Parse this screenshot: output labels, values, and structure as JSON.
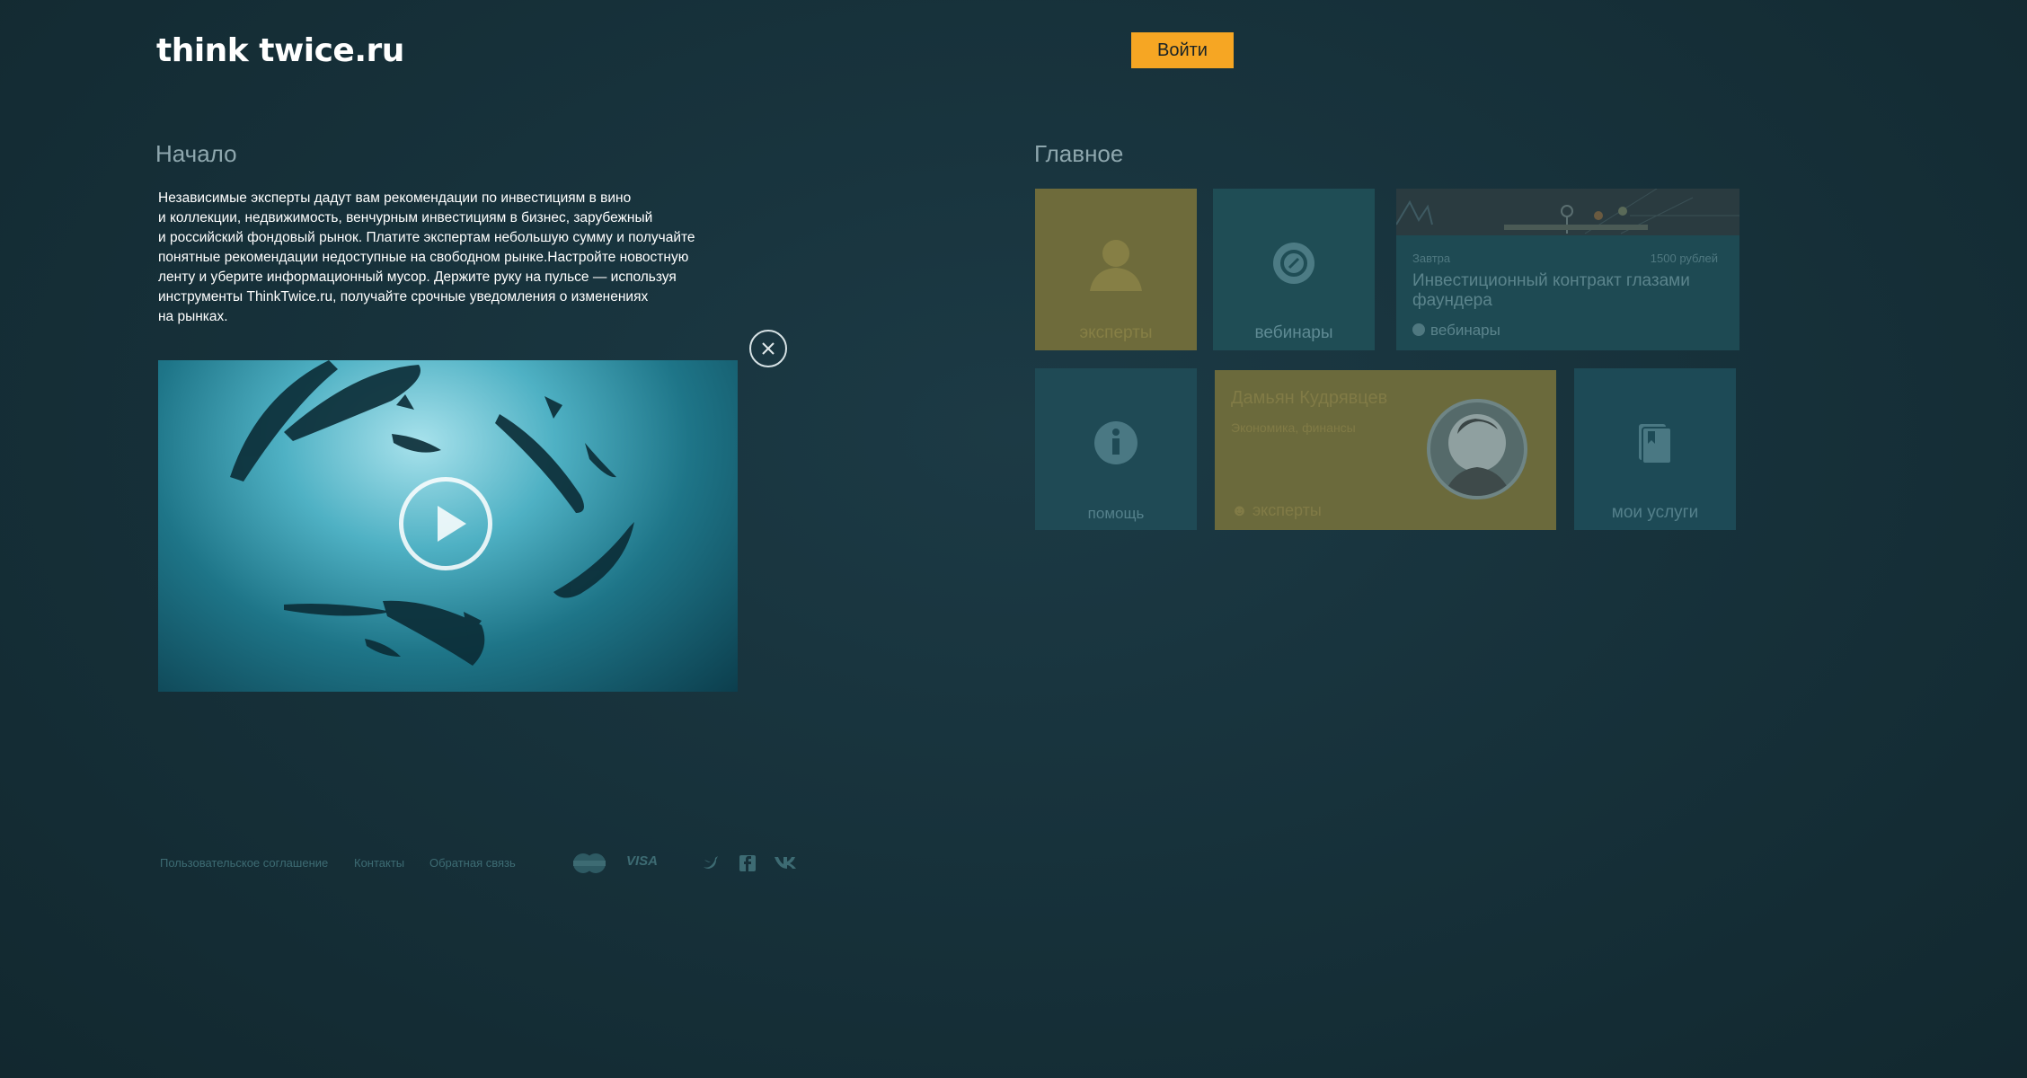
{
  "header": {
    "logo": "think twice.ru",
    "login_label": "Войти"
  },
  "start": {
    "title": "Начало",
    "intro_lines": [
      "Независимые эксперты дадут вам рекомендации по инвестициям в вино",
      "и коллекции, недвижимость, венчурным инвестициям в бизнес, зарубежный",
      "и российский фондовый рынок. Платите экспертам небольшую сумму и получайте",
      "понятные рекомендации недоступные на свободном рынке.Настройте новостную",
      "ленту и уберите информационный мусор. Держите руку на пульсе — используя",
      "инструменты ThinkTwice.ru, получайте срочные уведомления о изменениях",
      "на рынках."
    ]
  },
  "video": {
    "play_icon": "play-icon",
    "close_icon": "close-icon"
  },
  "main": {
    "title": "Главное",
    "tiles": {
      "experts": {
        "label": "эксперты",
        "icon": "person-icon"
      },
      "webinars": {
        "label": "вебинары",
        "icon": "webinar-icon"
      },
      "event": {
        "date": "Завтра",
        "price": "1500 рублей",
        "title": "Инвестиционный контракт глазами фаундера",
        "category": "вебинары"
      },
      "help": {
        "label": "помощь",
        "icon": "info-icon"
      },
      "expert_card": {
        "name": "Дамьян Кудрявцев",
        "field": "Экономика, финансы",
        "category": "эксперты"
      },
      "services": {
        "label": "мои услуги",
        "icon": "book-icon"
      }
    }
  },
  "footer": {
    "links": [
      "Пользовательское соглашение",
      "Контакты",
      "Обратная связь"
    ],
    "payments": {
      "mastercard": "MasterCard",
      "visa": "VISA"
    },
    "social": [
      "twitter-icon",
      "facebook-icon",
      "vk-icon"
    ]
  },
  "colors": {
    "accent": "#f6a623",
    "background": "#163039",
    "tile_yellow": "#6e6b3b",
    "tile_teal": "#1f4d55"
  }
}
